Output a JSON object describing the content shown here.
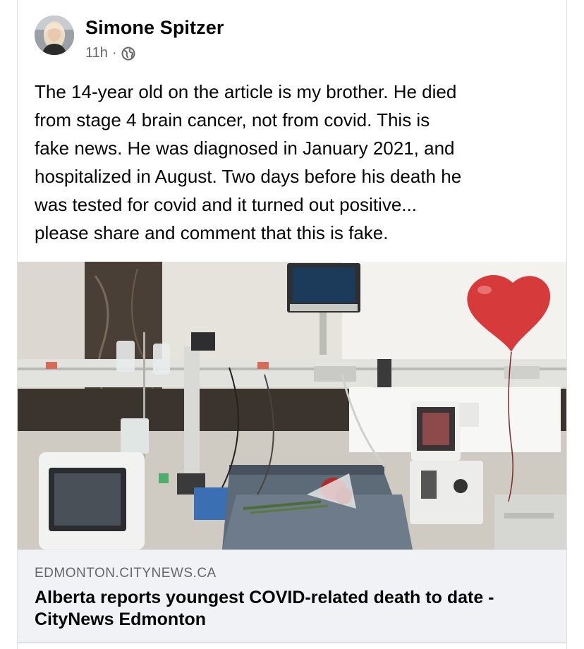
{
  "post": {
    "author": "Simone Spitzer",
    "time": "11h",
    "separator": "·",
    "privacy_icon": "globe-icon",
    "text_lines": [
      "The 14-year old on the article is my brother. He died",
      "from stage 4 brain cancer, not from covid. This is",
      "fake news. He was diagnosed in January 2021, and",
      "hospitalized in August. Two days before his death he",
      "was tested for covid and it turned out positive...",
      "please share and comment that this is fake."
    ]
  },
  "link_preview": {
    "domain": "EDMONTON.CITYNEWS.CA",
    "title": "Alberta reports youngest COVID-related death to date - CityNews Edmonton"
  },
  "colors": {
    "text_primary": "#050505",
    "text_secondary": "#65676b",
    "link_box_bg": "#f0f2f5",
    "balloon": "#d63a3a"
  }
}
